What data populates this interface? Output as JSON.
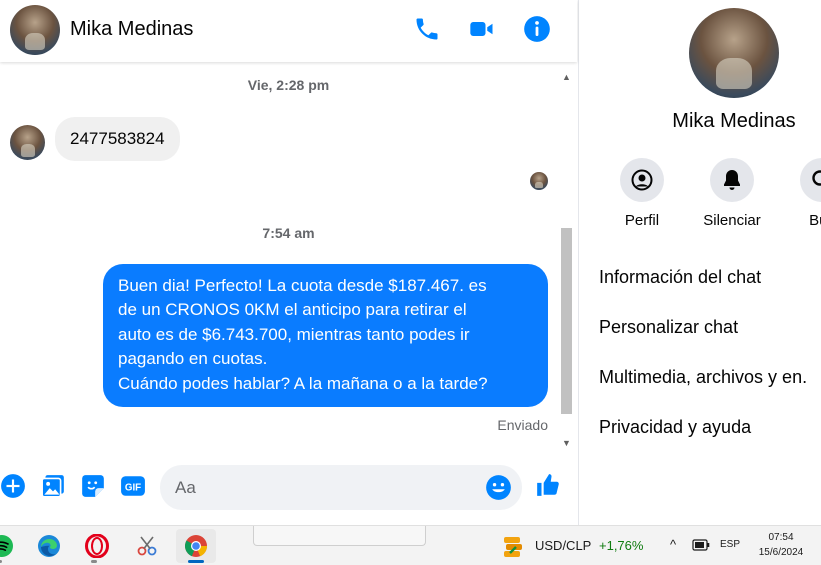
{
  "contact": {
    "name": "Mika Medinas"
  },
  "colors": {
    "accent": "#0084ff",
    "outgoing_bubble": "#0a7cff",
    "incoming_bubble": "#f0f0f0"
  },
  "header": {
    "icons": [
      "phone-icon",
      "video-camera-icon",
      "info-icon"
    ]
  },
  "messages": {
    "timestamp_1": "Vie, 2:28 pm",
    "incoming_1": "2477583824",
    "timestamp_2": "7:54 am",
    "outgoing_lines": [
      "Buen dia! Perfecto! La cuota desde $187.467. es",
      "de un CRONOS 0KM el anticipo para retirar el",
      "auto es de $6.743.700, mientras tanto podes ir",
      "pagando en cuotas.",
      "Cuándo podes hablar? A la mañana o a la tarde?"
    ],
    "status": "Enviado"
  },
  "composer": {
    "placeholder": "Aa",
    "icons": [
      "plus-icon",
      "gallery-icon",
      "sticker-icon",
      "gif-icon",
      "emoji-icon",
      "like-icon"
    ],
    "gif_label": "GIF"
  },
  "info_panel": {
    "name": "Mika Medinas",
    "actions": [
      {
        "label": "Perfil",
        "icon": "profile-icon"
      },
      {
        "label": "Silenciar",
        "icon": "bell-icon"
      },
      {
        "label": "Bus",
        "icon": "search-icon"
      }
    ],
    "items": [
      "Información del chat",
      "Personalizar chat",
      "Multimedia, archivos y en.",
      "Privacidad y ayuda"
    ]
  },
  "taskbar": {
    "apps": [
      "spotify-icon",
      "edge-icon",
      "opera-icon",
      "snipping-icon",
      "chrome-icon"
    ],
    "stock": {
      "name": "USD/CLP",
      "change": "+1,76%"
    },
    "tray": {
      "chevron": "^",
      "language": "ESP"
    },
    "clock": {
      "time": "07:54",
      "date": "15/6/2024"
    }
  }
}
